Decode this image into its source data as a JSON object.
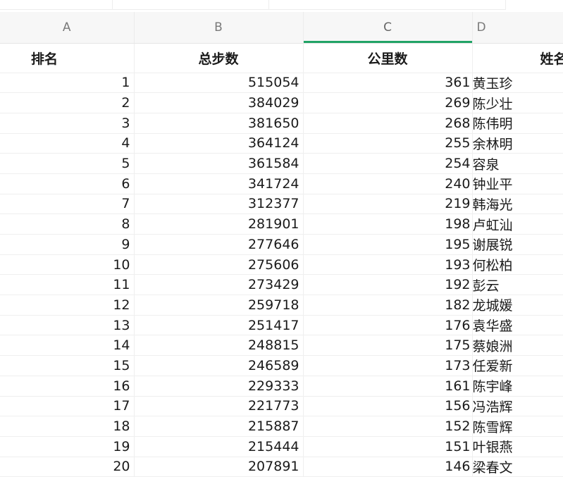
{
  "sheet": {
    "column_letters": [
      "A",
      "B",
      "C",
      "D"
    ],
    "selected_column": "C",
    "accent_color": "#21a366",
    "field_headers": {
      "rank": "排名",
      "steps": "总步数",
      "km": "公里数",
      "name": "姓名"
    },
    "rows": [
      {
        "rank": "1",
        "steps": "515054",
        "km": "361",
        "name": "黄玉珍"
      },
      {
        "rank": "2",
        "steps": "384029",
        "km": "269",
        "name": "陈少壮"
      },
      {
        "rank": "3",
        "steps": "381650",
        "km": "268",
        "name": "陈伟明"
      },
      {
        "rank": "4",
        "steps": "364124",
        "km": "255",
        "name": "余林明"
      },
      {
        "rank": "5",
        "steps": "361584",
        "km": "254",
        "name": "容泉"
      },
      {
        "rank": "6",
        "steps": "341724",
        "km": "240",
        "name": "钟业平"
      },
      {
        "rank": "7",
        "steps": "312377",
        "km": "219",
        "name": "韩海光"
      },
      {
        "rank": "8",
        "steps": "281901",
        "km": "198",
        "name": "卢虹汕"
      },
      {
        "rank": "9",
        "steps": "277646",
        "km": "195",
        "name": "谢展锐"
      },
      {
        "rank": "10",
        "steps": "275606",
        "km": "193",
        "name": "何松柏"
      },
      {
        "rank": "11",
        "steps": "273429",
        "km": "192",
        "name": "彭云"
      },
      {
        "rank": "12",
        "steps": "259718",
        "km": "182",
        "name": "龙城媛"
      },
      {
        "rank": "13",
        "steps": "251417",
        "km": "176",
        "name": "袁华盛"
      },
      {
        "rank": "14",
        "steps": "248815",
        "km": "175",
        "name": "蔡娘洲"
      },
      {
        "rank": "15",
        "steps": "246589",
        "km": "173",
        "name": "任爱新"
      },
      {
        "rank": "16",
        "steps": "229333",
        "km": "161",
        "name": "陈宇峰"
      },
      {
        "rank": "17",
        "steps": "221773",
        "km": "156",
        "name": "冯浩辉"
      },
      {
        "rank": "18",
        "steps": "215887",
        "km": "152",
        "name": "陈雪辉"
      },
      {
        "rank": "19",
        "steps": "215444",
        "km": "151",
        "name": "叶银燕"
      },
      {
        "rank": "20",
        "steps": "207891",
        "km": "146",
        "name": "梁春文"
      }
    ]
  }
}
